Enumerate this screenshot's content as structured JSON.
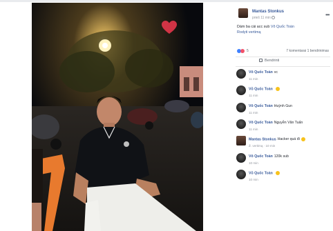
{
  "post": {
    "author": "Mantas Stonkus",
    "time": "prieš 11 min",
    "caption_text": "Dám ba cái acc sub ",
    "caption_tag": "Võ Quốc Toàn",
    "see_translation": "Rodyti vertimą",
    "more_label": "•••"
  },
  "reactions": {
    "count": "5",
    "comments_shares": "7 komentarai  1 bendrinimas"
  },
  "actions": {
    "share_label": "Bendrinti"
  },
  "comments": [
    {
      "name": "Võ Quốc Toàn",
      "text": "vc",
      "time": "11 min",
      "emoji": false
    },
    {
      "name": "Võ Quốc Toàn",
      "text": "",
      "time": "11 min",
      "emoji": true
    },
    {
      "name": "Võ Quốc Toàn",
      "text": "Huỳnh Gun",
      "time": "11 min",
      "emoji": false
    },
    {
      "name": "Võ Quốc Toàn",
      "text": "Nguyễn Văn Tuấn",
      "time": "11 min",
      "emoji": false
    },
    {
      "name": "Mantas Stonkus",
      "text": "Hacker quá đi",
      "time": "Ž. vertimą · 10 min",
      "emoji": true
    },
    {
      "name": "Võ Quốc Toàn",
      "text": "120k sub",
      "time": "10 min",
      "emoji": false
    },
    {
      "name": "Võ Quốc Toàn",
      "text": "",
      "time": "10 min",
      "emoji": true
    }
  ],
  "colors": {
    "link": "#365899",
    "text": "#1d2129",
    "muted": "#90949c",
    "heart": "#f0384f"
  },
  "photo": {
    "subject": "young man in black polo shirt and white pants sitting on chair at night street",
    "heart_icon": "heart-icon"
  }
}
